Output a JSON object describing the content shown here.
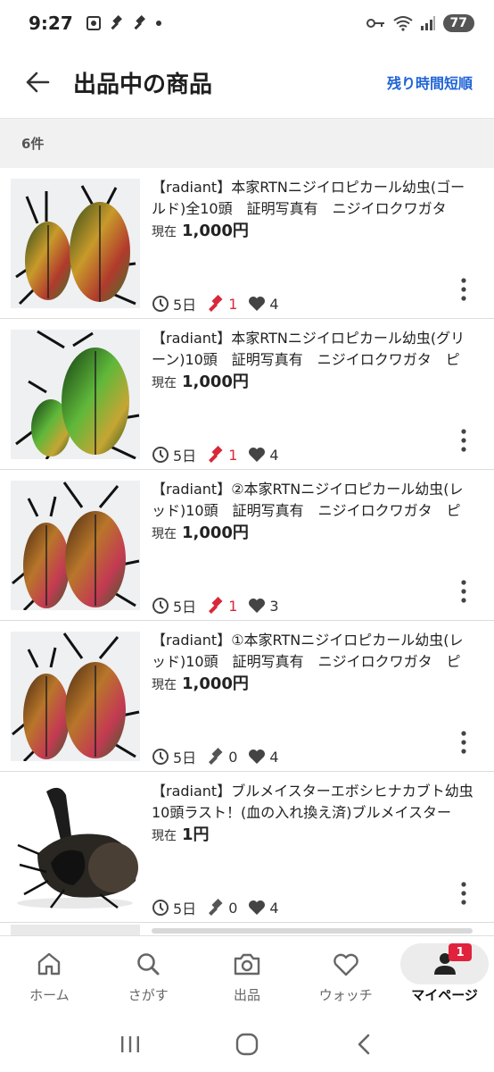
{
  "status_bar": {
    "time": "9:27",
    "battery": "77"
  },
  "header": {
    "title": "出品中の商品",
    "sort_label": "残り時間短順"
  },
  "count": "6件",
  "listings": [
    {
      "title": "【radiant】本家RTNニジイロピカール幼虫(ゴールド)全10頭　証明写真有　ニジイロクワガタ　ピ…",
      "price_label": "現在",
      "price": "1,000円",
      "days": "5日",
      "bids": "1",
      "watches": "4",
      "bid_active": true,
      "image": "beetle-gold"
    },
    {
      "title": "【radiant】本家RTNニジイロピカール幼虫(グリーン)10頭　証明写真有　ニジイロクワガタ　ピカ…",
      "price_label": "現在",
      "price": "1,000円",
      "days": "5日",
      "bids": "1",
      "watches": "4",
      "bid_active": true,
      "image": "beetle-green"
    },
    {
      "title": "【radiant】②本家RTNニジイロピカール幼虫(レッド)10頭　証明写真有　ニジイロクワガタ　ピカ…",
      "price_label": "現在",
      "price": "1,000円",
      "days": "5日",
      "bids": "1",
      "watches": "3",
      "bid_active": true,
      "image": "beetle-red"
    },
    {
      "title": "【radiant】①本家RTNニジイロピカール幼虫(レッド)10頭　証明写真有　ニジイロクワガタ　ピカ…",
      "price_label": "現在",
      "price": "1,000円",
      "days": "5日",
      "bids": "0",
      "watches": "4",
      "bid_active": false,
      "image": "beetle-red"
    },
    {
      "title": "【radiant】ブルメイスターエボシヒナカブト幼虫10頭ラスト！(血の入れ換え済)ブルメイスターエ…",
      "price_label": "現在",
      "price": "1円",
      "days": "5日",
      "bids": "0",
      "watches": "4",
      "bid_active": false,
      "image": "rhino-beetle"
    }
  ],
  "bottom_nav": {
    "items": [
      {
        "label": "ホーム",
        "icon": "home-icon"
      },
      {
        "label": "さがす",
        "icon": "search-icon"
      },
      {
        "label": "出品",
        "icon": "camera-icon"
      },
      {
        "label": "ウォッチ",
        "icon": "heart-icon"
      },
      {
        "label": "マイページ",
        "icon": "person-icon",
        "badge": "1"
      }
    ]
  },
  "colors": {
    "accent_blue": "#1f63d6",
    "bid_red": "#d8283a",
    "badge_red": "#e0223c"
  }
}
